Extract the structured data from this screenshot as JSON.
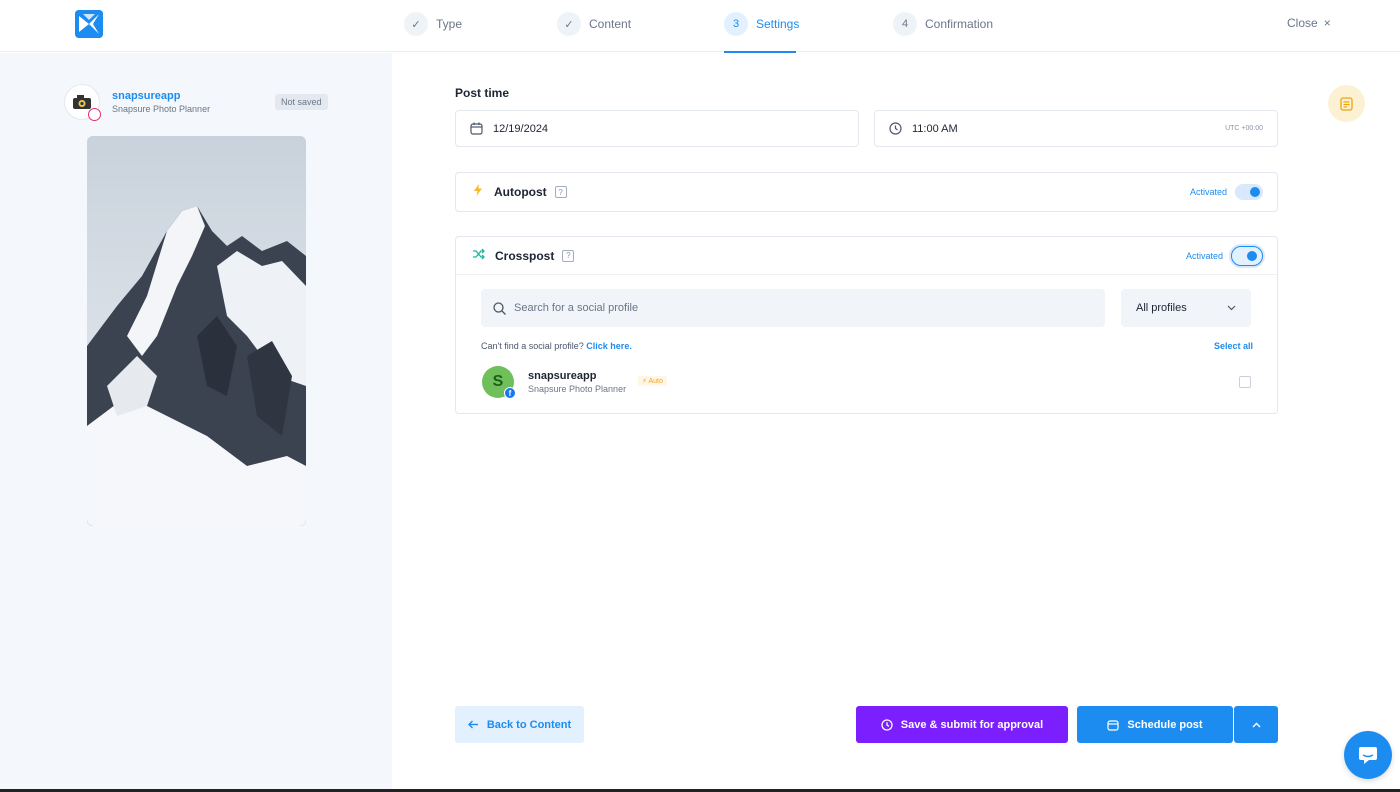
{
  "header": {
    "steps": [
      {
        "number": "✓",
        "label": "Type"
      },
      {
        "number": "✓",
        "label": "Content"
      },
      {
        "number": "3",
        "label": "Settings"
      },
      {
        "number": "4",
        "label": "Confirmation"
      }
    ],
    "active_step": "Settings",
    "close_label": "Close",
    "close_icon": "×"
  },
  "preview": {
    "profile_name": "snapsureapp",
    "profile_subtitle": "Snapsure Photo Planner",
    "status_badge": "Not saved",
    "network_icon": "instagram-icon"
  },
  "post_time": {
    "label": "Post time",
    "date": "12/19/2024",
    "time": "11:00 AM",
    "timezone": "UTC +00:00"
  },
  "autopost": {
    "title": "Autopost",
    "help": "?",
    "status": "Activated",
    "enabled": true
  },
  "crosspost": {
    "title": "Crosspost",
    "help": "?",
    "status": "Activated",
    "enabled": true,
    "search_placeholder": "Search for a social profile",
    "filter_value": "All profiles",
    "cant_find_text": "Can't find a social profile?",
    "click_here": "Click here.",
    "select_all": "Select all",
    "profiles": [
      {
        "initial": "S",
        "name": "snapsureapp",
        "subtitle": "Snapsure Photo Planner",
        "badge": "Auto",
        "network_badge": "f",
        "checked": false
      }
    ]
  },
  "footer": {
    "back_label": "Back to Content",
    "approve_label": "Save & submit for approval",
    "schedule_label": "Schedule post"
  },
  "colors": {
    "accent": "#1d8cf0",
    "approve": "#7b1fff",
    "panel_bg": "#f4f7fb",
    "auto_badge": "#f5a623"
  }
}
